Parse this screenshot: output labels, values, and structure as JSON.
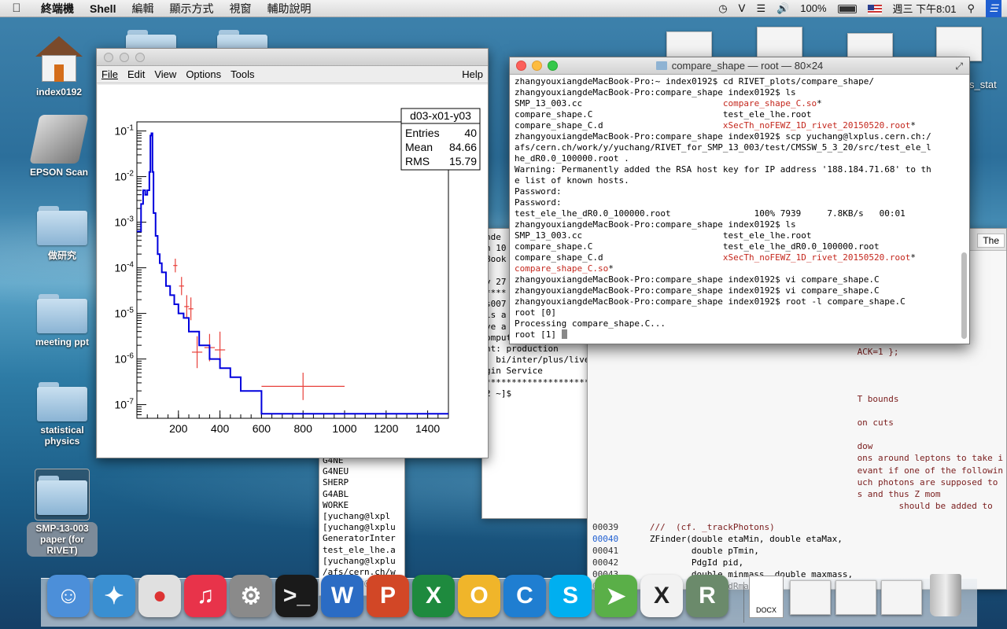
{
  "menubar": {
    "app": "終端機",
    "items": [
      "Shell",
      "編輯",
      "顯示方式",
      "視窗",
      "輔助說明"
    ],
    "battery": "100%",
    "clock": "週三 下午8:01"
  },
  "desktop_icons": [
    {
      "label": "index0192"
    },
    {
      "label": "EPSON Scan"
    },
    {
      "label": "做研究"
    },
    {
      "label": "meeting ppt"
    },
    {
      "label": "statistical physics"
    },
    {
      "label": "SMP-13-003 paper (for RIVET)"
    }
  ],
  "root_window": {
    "menu": [
      "File",
      "Edit",
      "View",
      "Options",
      "Tools"
    ],
    "help": "Help"
  },
  "chart_data": {
    "type": "histogram",
    "title": "",
    "stats_box": {
      "name": "d03-x01-y03",
      "Entries": "40",
      "Mean": "84.66",
      "RMS": "15.79"
    },
    "x_ticks": [
      "200",
      "400",
      "600",
      "800",
      "1000",
      "1200",
      "1400"
    ],
    "y_ticks": [
      "10^-1",
      "10^-2",
      "10^-3",
      "10^-4",
      "10^-5",
      "10^-6",
      "10^-7"
    ],
    "xlim": [
      0,
      1500
    ],
    "ylog": true,
    "ylim_exp": [
      -7.3,
      -0.8
    ],
    "blue_histogram": {
      "x_edges": [
        0,
        20,
        30,
        40,
        50,
        60,
        65,
        70,
        75,
        80,
        90,
        100,
        110,
        120,
        140,
        160,
        180,
        200,
        225,
        250,
        300,
        350,
        400,
        450,
        500,
        600,
        700,
        800,
        1000,
        1500
      ],
      "log10_values": [
        -3.2,
        -2.6,
        -2.3,
        -2.4,
        -2.3,
        -1.9,
        -1.1,
        -1.05,
        -1.9,
        -2.8,
        -3.3,
        -3.7,
        -3.9,
        -4.1,
        -4.4,
        -4.6,
        -4.8,
        -5.0,
        -5.1,
        -5.4,
        -5.7,
        -6.0,
        -6.2,
        -6.4,
        -6.7,
        -7.2,
        -7.2,
        -7.2,
        -7.2
      ]
    },
    "red_points": [
      {
        "x": 185,
        "log10_y": -3.95,
        "xerr": 10,
        "err_lo": 0.15,
        "err_hi": 0.15
      },
      {
        "x": 215,
        "log10_y": -4.4,
        "xerr": 12,
        "err_lo": 0.2,
        "err_hi": 0.2
      },
      {
        "x": 240,
        "log10_y": -4.85,
        "xerr": 12,
        "err_lo": 0.25,
        "err_hi": 0.25
      },
      {
        "x": 260,
        "log10_y": -4.9,
        "xerr": 12,
        "err_lo": 0.25,
        "err_hi": 0.25
      },
      {
        "x": 290,
        "log10_y": -5.85,
        "xerr": 25,
        "err_lo": 0.35,
        "err_hi": 0.35
      },
      {
        "x": 350,
        "log10_y": -5.75,
        "xerr": 25,
        "err_lo": 0.3,
        "err_hi": 0.3
      },
      {
        "x": 400,
        "log10_y": -5.8,
        "xerr": 25,
        "err_lo": 0.4,
        "err_hi": 0.4
      },
      {
        "x": 800,
        "log10_y": -6.6,
        "xerr": 200,
        "err_lo": 0.3,
        "err_hi": 0.3
      }
    ]
  },
  "terminal": {
    "title": "compare_shape — root — 80×24",
    "lines": [
      [
        {
          "t": "zhangyouxiangdeMacBook-Pro:~ index0192$ cd RIVET_plots/compare_shape/"
        }
      ],
      [
        {
          "t": "zhangyouxiangdeMacBook-Pro:compare_shape index0192$ ls"
        }
      ],
      [
        {
          "t": "SMP_13_003.cc                           "
        },
        {
          "t": "compare_shape_C.so",
          "c": "red"
        },
        {
          "t": "*"
        }
      ],
      [
        {
          "t": "compare_shape.C                         test_ele_lhe.root"
        }
      ],
      [
        {
          "t": "compare_shape_C.d                       "
        },
        {
          "t": "xSecTh_noFEWZ_1D_rivet_20150520.root",
          "c": "red"
        },
        {
          "t": "*"
        }
      ],
      [
        {
          "t": "zhangyouxiangdeMacBook-Pro:compare_shape index0192$ scp yuchang@lxplus.cern.ch:/"
        }
      ],
      [
        {
          "t": "afs/cern.ch/work/y/yuchang/RIVET_for_SMP_13_003/test/CMSSW_5_3_20/src/test_ele_l"
        }
      ],
      [
        {
          "t": "he_dR0.0_100000.root ."
        }
      ],
      [
        {
          "t": "Warning: Permanently added the RSA host key for IP address '188.184.71.68' to th"
        }
      ],
      [
        {
          "t": "e list of known hosts."
        }
      ],
      [
        {
          "t": "Password:"
        }
      ],
      [
        {
          "t": "Password:"
        }
      ],
      [
        {
          "t": "test_ele_lhe_dR0.0_100000.root                100% 7939     7.8KB/s   00:01"
        }
      ],
      [
        {
          "t": "zhangyouxiangdeMacBook-Pro:compare_shape index0192$ ls"
        }
      ],
      [
        {
          "t": "SMP_13_003.cc                           test_ele_lhe.root"
        }
      ],
      [
        {
          "t": "compare_shape.C                         test_ele_lhe_dR0.0_100000.root"
        }
      ],
      [
        {
          "t": "compare_shape_C.d                       "
        },
        {
          "t": "xSecTh_noFEWZ_1D_rivet_20150520.root",
          "c": "red"
        },
        {
          "t": "*"
        }
      ],
      [
        {
          "t": "compare_shape_C.so",
          "c": "red"
        },
        {
          "t": "*"
        }
      ],
      [
        {
          "t": "zhangyouxiangdeMacBook-Pro:compare_shape index0192$ vi compare_shape.C"
        }
      ],
      [
        {
          "t": "zhangyouxiangdeMacBook-Pro:compare_shape index0192$ vi compare_shape.C"
        }
      ],
      [
        {
          "t": "zhangyouxiangdeMacBook-Pro:compare_shape index0192$ root -l compare_shape.C"
        }
      ],
      [
        {
          "t": "root [0]"
        }
      ],
      [
        {
          "t": "Processing compare_shape.C..."
        }
      ],
      [
        {
          "t": "root [1] "
        }
      ]
    ]
  },
  "bg_terminal_lines": [
    "nde",
    "n 10",
    "Book",
    "",
    "y 27",
    "****",
    "s007",
    "is a",
    "ve a",
    "omputingRules",
    "nt: production",
    ": bi/inter/plus/live/login",
    "gin Service",
    "*****************************************************",
    "2 ~]$ "
  ],
  "bg_left_lines": [
    "G4NE",
    "G4NEU",
    "SHERP",
    "G4ABL",
    "WORKE",
    "[yuchang@lxpl",
    "[yuchang@lxplu",
    "GeneratorInter",
    "test_ele_lhe.a",
    "[yuchang@lxplu",
    "/afs/cern.ch/w",
    "[yuchang@lxplu"
  ],
  "editor_right_lines": [
    " findi",
    "lusteri",
    "",
    "",
    "",
    "TERALL",
    "ACK=1 };",
    "",
    "",
    "",
    "T bounds",
    "",
    "on cuts",
    "",
    "dow",
    "ons around leptons to take i",
    "evant if one of the followin",
    "uch photons are supposed to",
    "s and thus Z mom",
    "        should be added to"
  ],
  "editor_code": [
    {
      "n": "00039",
      "t": "    ///  (cf. _trackPhotons)"
    },
    {
      "n": "00040",
      "t": "    ZFinder(double etaMin, double etaMax,"
    },
    {
      "n": "00041",
      "t": "            double pTmin,"
    },
    {
      "n": "00042",
      "t": "            PdgId pid,"
    },
    {
      "n": "00043",
      "t": "            double minmass, double maxmass,"
    },
    {
      "n": "00044",
      "t": "            double dRmax=0.1,"
    }
  ],
  "safari_tab": "The",
  "stat_label": "s_stat",
  "dock_items": [
    "Finder",
    "Safari",
    "Chrome",
    "iTunes",
    "System Preferences",
    "Terminal",
    "Word",
    "PowerPoint",
    "Excel",
    "Outlook",
    "C",
    "Skype",
    "Maps",
    "X11",
    "Root"
  ],
  "dock_docx": "DOCX"
}
